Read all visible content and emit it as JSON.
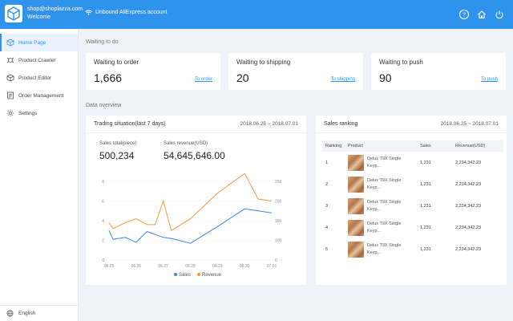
{
  "header": {
    "account_email": "shop@shoplazza.com",
    "account_welcome": "Welcome",
    "unbound_text": "Unbound AliExpress account",
    "icons": [
      "help-icon",
      "home-icon",
      "power-icon"
    ]
  },
  "sidebar": {
    "items": [
      {
        "label": "Home Page",
        "icon": "cube-icon",
        "active": true
      },
      {
        "label": "Product Crawler",
        "icon": "crawler-icon"
      },
      {
        "label": "Product Editor",
        "icon": "editor-icon"
      },
      {
        "label": "Order Management",
        "icon": "order-icon"
      },
      {
        "label": "Settings",
        "icon": "gear-icon"
      }
    ],
    "language": "English"
  },
  "todo": {
    "section_title": "Waiting to do",
    "cards": [
      {
        "title": "Waiting to order",
        "value": "1,666",
        "link": "To order"
      },
      {
        "title": "Waiting to shipping",
        "value": "20",
        "link": "To shipping"
      },
      {
        "title": "Waiting to push",
        "value": "90",
        "link": "To push"
      }
    ]
  },
  "overview": {
    "section_title": "Data overview",
    "trading": {
      "title": "Trading situation(last 7 days)",
      "date_range": "2018.06.25 ~ 2018.07.01",
      "sales_total_label": "Sales total(piece)",
      "sales_total_value": "500,234",
      "revenue_label": "Sales revenue(USD)",
      "revenue_value": "54,645,646.00"
    },
    "ranking": {
      "title": "Sales ranking",
      "date_range": "2018.06.25 ~ 2018.07.01",
      "columns": [
        "Ranking",
        "Product",
        "Sales",
        "Revenue(USD)"
      ],
      "rows": [
        {
          "rank": "1",
          "product_line1": "Delux T9X Single",
          "product_line2": "Keyp...",
          "sales": "1,231",
          "revenue": "2,234,342.23"
        },
        {
          "rank": "2",
          "product_line1": "Delux T9X Single",
          "product_line2": "Keyp...",
          "sales": "1,231",
          "revenue": "2,234,342.23"
        },
        {
          "rank": "3",
          "product_line1": "Delux T9X Single",
          "product_line2": "Keyp...",
          "sales": "1,231",
          "revenue": "2,234,342.23"
        },
        {
          "rank": "4",
          "product_line1": "Delux T9X Single",
          "product_line2": "Keyp...",
          "sales": "1,231",
          "revenue": "2,234,342.23"
        },
        {
          "rank": "5",
          "product_line1": "Delux T9X Single",
          "product_line2": "Keyp...",
          "sales": "1,231",
          "revenue": "2,234,342.23"
        }
      ]
    }
  },
  "colors": {
    "brand": "#2f93ee",
    "sales_line": "#3d85e8",
    "revenue_line": "#f39a3c"
  },
  "chart_data": {
    "type": "line",
    "categories": [
      "06.25",
      "06.26",
      "06.27",
      "06.28",
      "06.29",
      "06.30",
      "07.01"
    ],
    "x": [
      0,
      0.15,
      0.6,
      1,
      1.4,
      1.7,
      2,
      2.3,
      3,
      4,
      5,
      5.5,
      6
    ],
    "series": [
      {
        "name": "Sales",
        "axis": "left",
        "color": "#3d85e8",
        "values": [
          3,
          2.1,
          2.3,
          1.8,
          2.9,
          2.6,
          2.3,
          2.2,
          1.7,
          3.4,
          5.2,
          5.0,
          4.8
        ]
      },
      {
        "name": "Revenue",
        "axis": "right",
        "color": "#f39a3c",
        "values": [
          145,
          130,
          145,
          155,
          140,
          140,
          200,
          125,
          155,
          220,
          270,
          205,
          200
        ]
      }
    ],
    "y_left": {
      "ticks": [
        "0",
        "2",
        "4",
        "6",
        "8"
      ],
      "min": 0,
      "max": 8
    },
    "y_right": {
      "ticks": [
        "0",
        "100",
        "150",
        "200",
        "250"
      ],
      "min": 50,
      "max": 250
    },
    "legend": [
      "Sales",
      "Revenue"
    ],
    "legend_position": "bottom",
    "grid": true
  }
}
